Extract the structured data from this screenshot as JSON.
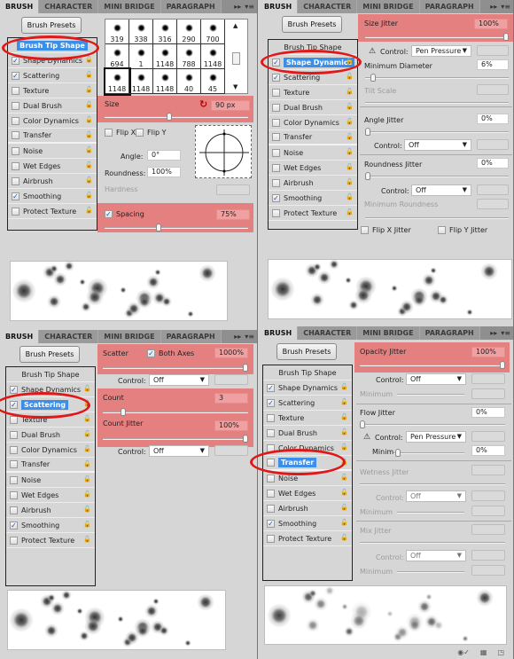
{
  "tabs": [
    "BRUSH",
    "CHARACTER",
    "MINI BRIDGE",
    "PARAGRAPH"
  ],
  "tab_controls": {
    "expand": "▸▸",
    "menu": "▾≡"
  },
  "brush_presets_label": "Brush Presets",
  "panels": [
    {
      "id": "brush-tip-shape",
      "list": [
        {
          "label": "Brush Tip Shape",
          "header": true,
          "selected": true
        },
        {
          "label": "Shape Dynamics",
          "checked": true
        },
        {
          "label": "Scattering",
          "checked": true
        },
        {
          "label": "Texture",
          "checked": false
        },
        {
          "label": "Dual Brush",
          "checked": false
        },
        {
          "label": "Color Dynamics",
          "checked": false
        },
        {
          "label": "Transfer",
          "checked": false
        },
        {
          "label": "Noise",
          "checked": false
        },
        {
          "label": "Wet Edges",
          "checked": false
        },
        {
          "label": "Airbrush",
          "checked": false
        },
        {
          "label": "Smoothing",
          "checked": true
        },
        {
          "label": "Protect Texture",
          "checked": false
        }
      ],
      "tip_grid": [
        "319",
        "338",
        "316",
        "290",
        "700",
        "694",
        "1",
        "1148",
        "788",
        "1148",
        "1148",
        "1148",
        "1148",
        "40",
        "45"
      ],
      "size_label": "Size",
      "size_value": "90 px",
      "size_slider": 0.3,
      "flip_x": "Flip X",
      "flip_y": "Flip Y",
      "angle_label": "Angle:",
      "angle_value": "0°",
      "roundness_label": "Roundness:",
      "roundness_value": "100%",
      "hardness_label": "Hardness",
      "spacing_label": "Spacing",
      "spacing_value": "75%",
      "spacing_slider": 0.37
    },
    {
      "id": "shape-dynamics",
      "selected_item": "Shape Dynamics",
      "size_jitter_label": "Size Jitter",
      "size_jitter_value": "100%",
      "control_label": "Control:",
      "control_1": "Pen Pressure",
      "min_diameter_label": "Minimum Diameter",
      "min_diameter_value": "6%",
      "tilt_scale_label": "Tilt Scale",
      "angle_jitter_label": "Angle Jitter",
      "angle_jitter_value": "0%",
      "control_2": "Off",
      "roundness_jitter_label": "Roundness Jitter",
      "roundness_jitter_value": "0%",
      "control_3": "Off",
      "min_roundness_label": "Minimum Roundness",
      "flip_x_jitter": "Flip X Jitter",
      "flip_y_jitter": "Flip Y Jitter"
    },
    {
      "id": "scattering",
      "selected_item": "Scattering",
      "scatter_label": "Scatter",
      "both_axes_label": "Both Axes",
      "scatter_value": "1000%",
      "control_label": "Control:",
      "control_1": "Off",
      "count_label": "Count",
      "count_value": "3",
      "count_jitter_label": "Count Jitter",
      "count_jitter_value": "100%",
      "control_2": "Off"
    },
    {
      "id": "transfer",
      "selected_item": "Transfer",
      "opacity_jitter_label": "Opacity Jitter",
      "opacity_jitter_value": "100%",
      "control_label": "Control:",
      "control_1": "Off",
      "minimum_label": "Minimum",
      "flow_jitter_label": "Flow Jitter",
      "flow_jitter_value": "0%",
      "control_2": "Pen Pressure",
      "minimum_short_label": "Minim",
      "flow_minimum_value": "0%",
      "wetness_jitter_label": "Wetness Jitter",
      "control_3": "Off",
      "mix_jitter_label": "Mix Jitter",
      "control_4": "Off"
    }
  ],
  "highlight_color": "#e86868",
  "selection_color": "#3b8fe9",
  "annotation_ring_color": "#e01818"
}
